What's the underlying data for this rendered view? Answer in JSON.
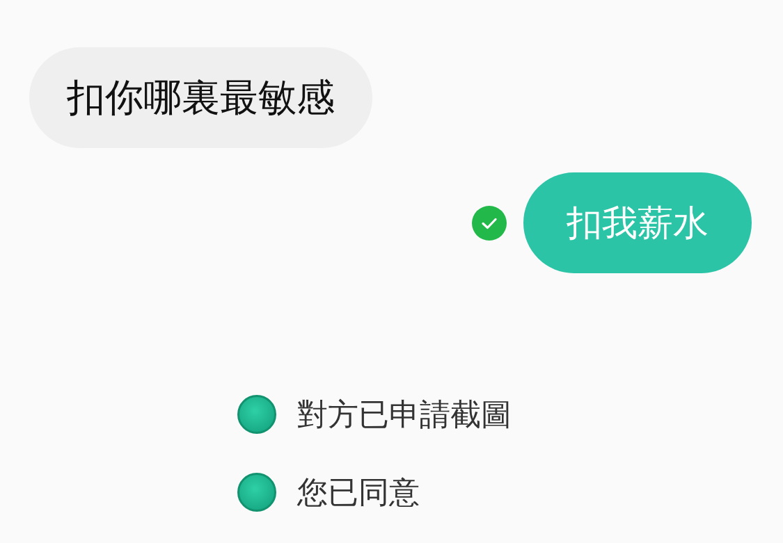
{
  "messages": [
    {
      "kind": "incoming",
      "text": "扣你哪裏最敏感",
      "delivered": false
    },
    {
      "kind": "outgoing",
      "text": "扣我薪水",
      "delivered": true
    }
  ],
  "notices": [
    {
      "text": "對方已申請截圖"
    },
    {
      "text": "您已同意"
    }
  ]
}
